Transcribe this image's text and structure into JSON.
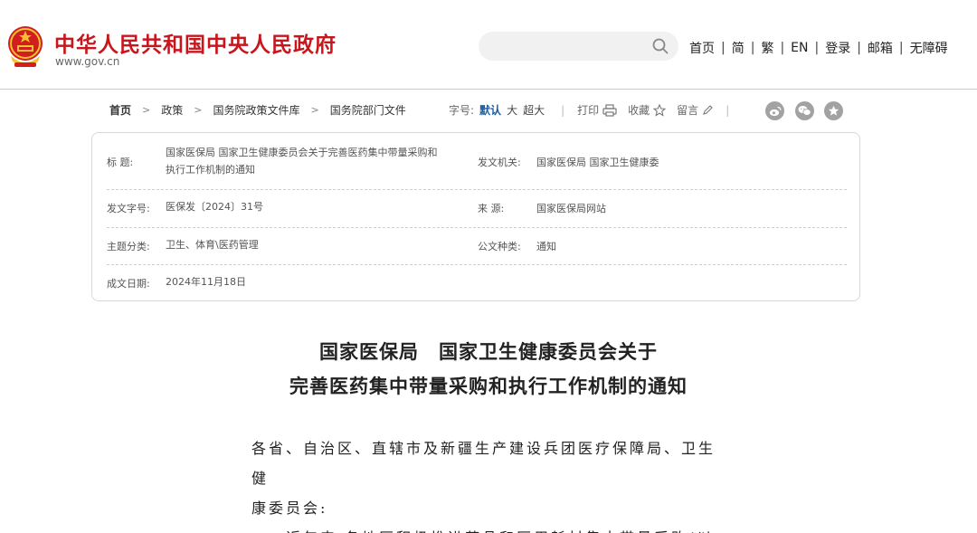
{
  "header": {
    "site_title": "中华人民共和国中央人民政府",
    "site_url": "www.gov.cn",
    "nav": [
      "首页",
      "简",
      "繁",
      "EN",
      "登录",
      "邮箱",
      "无障碍"
    ]
  },
  "breadcrumb": [
    "首页",
    "政策",
    "国务院政策文件库",
    "国务院部门文件"
  ],
  "tools": {
    "font_label": "字号:",
    "font_default": "默认",
    "font_large": "大",
    "font_xlarge": "超大",
    "print": "打印",
    "favorite": "收藏",
    "comment": "留言"
  },
  "meta": {
    "title_label": "标    题:",
    "title_line1": "国家医保局 国家卫生健康委员会关于完善医药集中带量采购和",
    "title_line2": "执行工作机制的通知",
    "issuer_label": "发文机关:",
    "issuer_value": "国家医保局 国家卫生健康委",
    "docno_label": "发文字号:",
    "docno_value": "医保发〔2024〕31号",
    "source_label": "来    源:",
    "source_value": "国家医保局网站",
    "category_label": "主题分类:",
    "category_value": "卫生、体育\\医药管理",
    "doctype_label": "公文种类:",
    "doctype_value": "通知",
    "date_label": "成文日期:",
    "date_value": "2024年11月18日"
  },
  "article": {
    "title_line1": "国家医保局　国家卫生健康委员会关于",
    "title_line2": "完善医药集中带量采购和执行工作机制的通知",
    "recipient_line1": "各省、自治区、直辖市及新疆生产建设兵团医疗保障局、卫生健",
    "recipient_line2": "康委员会:",
    "para1_line1": "　　近年来,各地区积极推进药品和医用耗材集中带量采购(以"
  },
  "colors": {
    "brand_red": "#c8161d",
    "link_blue": "#1b5c9f",
    "icon_gray": "#a2a2a2"
  },
  "icons": [
    "national-emblem-icon",
    "search-icon",
    "print-icon",
    "star-icon",
    "pencil-icon",
    "weibo-icon",
    "wechat-icon",
    "bookmark-star-icon"
  ]
}
